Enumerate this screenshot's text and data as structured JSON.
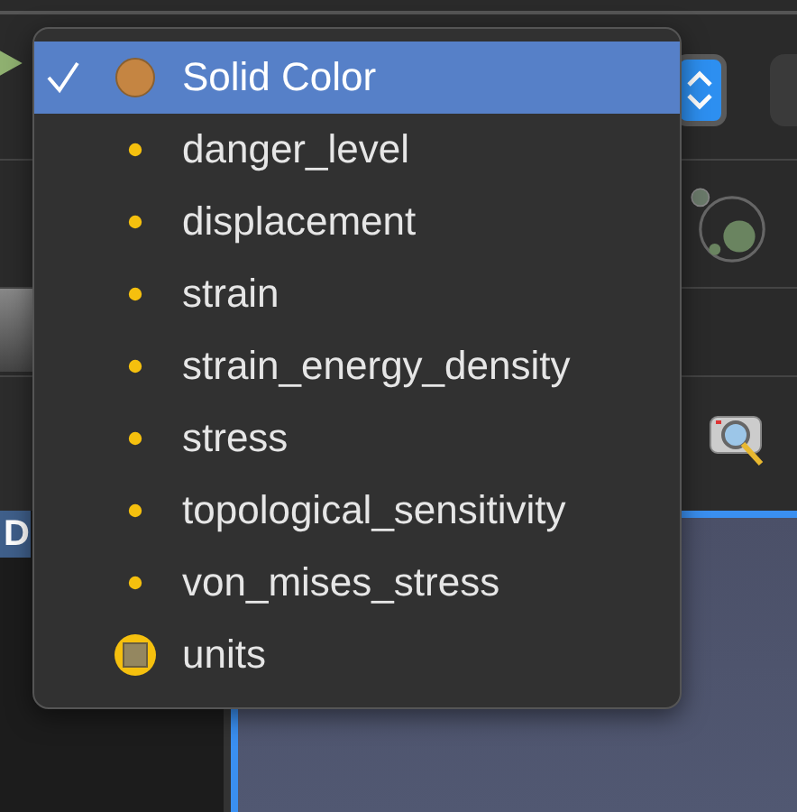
{
  "sidebar": {
    "items": [
      {
        "label": "D",
        "selected": true
      }
    ]
  },
  "popup_menu": {
    "items": [
      {
        "label": "Solid Color",
        "kind": "solid",
        "selected": true
      },
      {
        "label": "danger_level",
        "kind": "field",
        "selected": false
      },
      {
        "label": "displacement",
        "kind": "field",
        "selected": false
      },
      {
        "label": "strain",
        "kind": "field",
        "selected": false
      },
      {
        "label": "strain_energy_density",
        "kind": "field",
        "selected": false
      },
      {
        "label": "stress",
        "kind": "field",
        "selected": false
      },
      {
        "label": "topological_sensitivity",
        "kind": "field",
        "selected": false
      },
      {
        "label": "von_mises_stress",
        "kind": "field",
        "selected": false
      },
      {
        "label": "units",
        "kind": "units",
        "selected": false
      }
    ]
  }
}
